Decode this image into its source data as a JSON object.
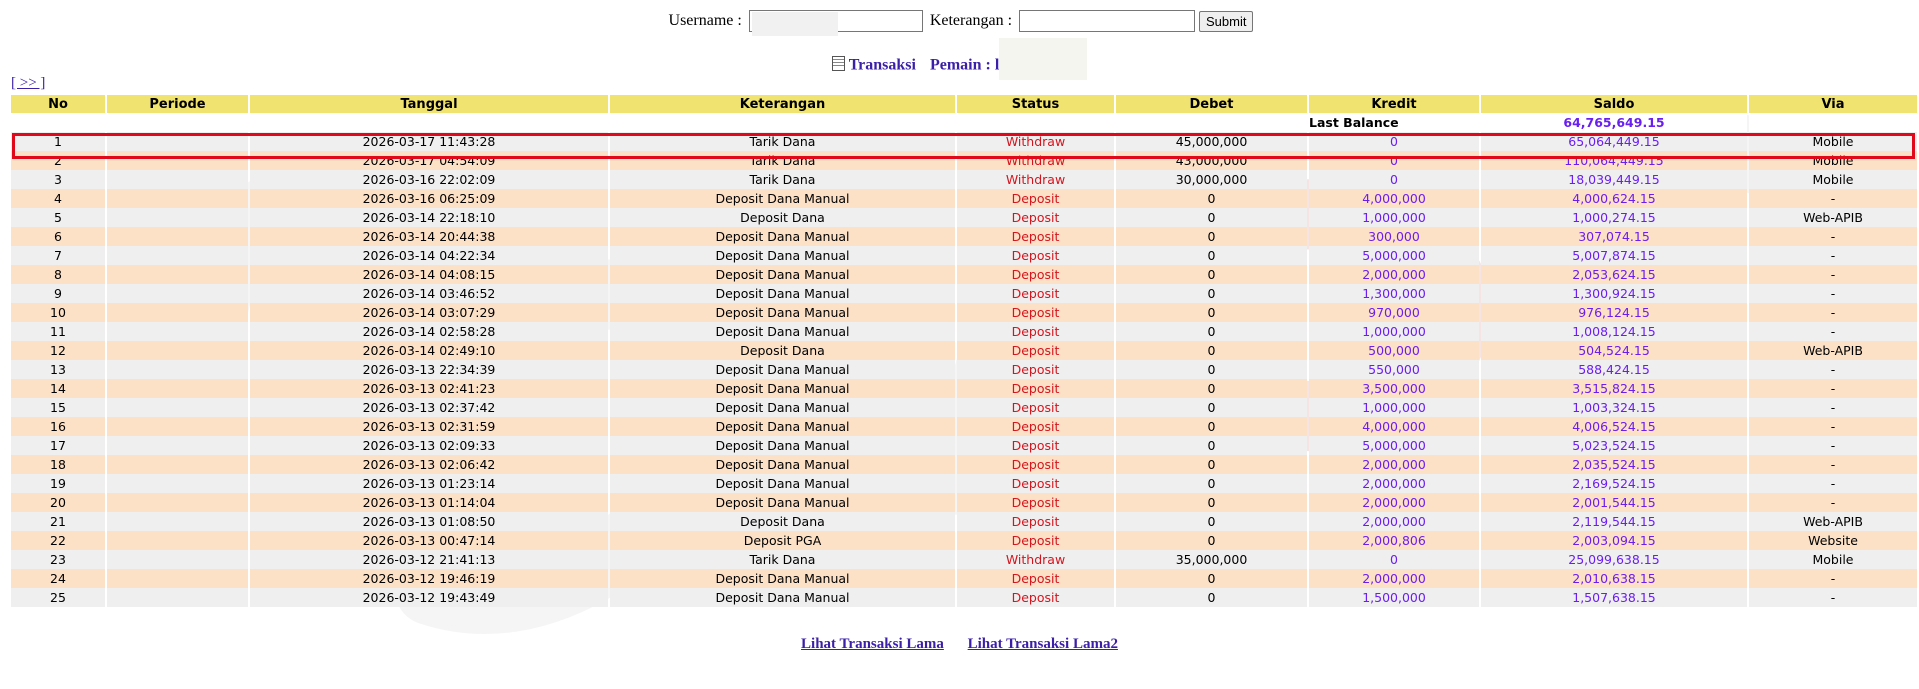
{
  "search": {
    "username_label": "Username :",
    "username_value": "l",
    "keterangan_label": "Keterangan :",
    "keterangan_value": "",
    "submit_label": "Submit"
  },
  "heading": {
    "title": "Transaksi",
    "player_label": "Pemain : l"
  },
  "nav": {
    "next_label": "[ >> ]"
  },
  "table": {
    "columns": [
      "No",
      "Periode",
      "Tanggal",
      "Keterangan",
      "Status",
      "Debet",
      "Kredit",
      "Saldo",
      "Via"
    ],
    "last_balance_label": "Last Balance",
    "last_balance_value": "64,765,649.15",
    "rows": [
      {
        "no": "1",
        "periode": "",
        "tanggal": "2026-03-17 11:43:28",
        "keterangan": "Tarik Dana",
        "status": "Withdraw",
        "debet": "45,000,000",
        "kredit": "0",
        "saldo": "65,064,449.15",
        "via": "Mobile"
      },
      {
        "no": "2",
        "periode": "",
        "tanggal": "2026-03-17 04:54:09",
        "keterangan": "Tarik Dana",
        "status": "Withdraw",
        "debet": "43,000,000",
        "kredit": "0",
        "saldo": "110,064,449.15",
        "via": "Mobile"
      },
      {
        "no": "3",
        "periode": "",
        "tanggal": "2026-03-16 22:02:09",
        "keterangan": "Tarik Dana",
        "status": "Withdraw",
        "debet": "30,000,000",
        "kredit": "0",
        "saldo": "18,039,449.15",
        "via": "Mobile"
      },
      {
        "no": "4",
        "periode": "",
        "tanggal": "2026-03-16 06:25:09",
        "keterangan": "Deposit Dana Manual",
        "status": "Deposit",
        "debet": "0",
        "kredit": "4,000,000",
        "saldo": "4,000,624.15",
        "via": "-"
      },
      {
        "no": "5",
        "periode": "",
        "tanggal": "2026-03-14 22:18:10",
        "keterangan": "Deposit Dana",
        "status": "Deposit",
        "debet": "0",
        "kredit": "1,000,000",
        "saldo": "1,000,274.15",
        "via": "Web-APIB"
      },
      {
        "no": "6",
        "periode": "",
        "tanggal": "2026-03-14 20:44:38",
        "keterangan": "Deposit Dana Manual",
        "status": "Deposit",
        "debet": "0",
        "kredit": "300,000",
        "saldo": "307,074.15",
        "via": "-"
      },
      {
        "no": "7",
        "periode": "",
        "tanggal": "2026-03-14 04:22:34",
        "keterangan": "Deposit Dana Manual",
        "status": "Deposit",
        "debet": "0",
        "kredit": "5,000,000",
        "saldo": "5,007,874.15",
        "via": "-"
      },
      {
        "no": "8",
        "periode": "",
        "tanggal": "2026-03-14 04:08:15",
        "keterangan": "Deposit Dana Manual",
        "status": "Deposit",
        "debet": "0",
        "kredit": "2,000,000",
        "saldo": "2,053,624.15",
        "via": "-"
      },
      {
        "no": "9",
        "periode": "",
        "tanggal": "2026-03-14 03:46:52",
        "keterangan": "Deposit Dana Manual",
        "status": "Deposit",
        "debet": "0",
        "kredit": "1,300,000",
        "saldo": "1,300,924.15",
        "via": "-"
      },
      {
        "no": "10",
        "periode": "",
        "tanggal": "2026-03-14 03:07:29",
        "keterangan": "Deposit Dana Manual",
        "status": "Deposit",
        "debet": "0",
        "kredit": "970,000",
        "saldo": "976,124.15",
        "via": "-"
      },
      {
        "no": "11",
        "periode": "",
        "tanggal": "2026-03-14 02:58:28",
        "keterangan": "Deposit Dana Manual",
        "status": "Deposit",
        "debet": "0",
        "kredit": "1,000,000",
        "saldo": "1,008,124.15",
        "via": "-"
      },
      {
        "no": "12",
        "periode": "",
        "tanggal": "2026-03-14 02:49:10",
        "keterangan": "Deposit Dana",
        "status": "Deposit",
        "debet": "0",
        "kredit": "500,000",
        "saldo": "504,524.15",
        "via": "Web-APIB"
      },
      {
        "no": "13",
        "periode": "",
        "tanggal": "2026-03-13 22:34:39",
        "keterangan": "Deposit Dana Manual",
        "status": "Deposit",
        "debet": "0",
        "kredit": "550,000",
        "saldo": "588,424.15",
        "via": "-"
      },
      {
        "no": "14",
        "periode": "",
        "tanggal": "2026-03-13 02:41:23",
        "keterangan": "Deposit Dana Manual",
        "status": "Deposit",
        "debet": "0",
        "kredit": "3,500,000",
        "saldo": "3,515,824.15",
        "via": "-"
      },
      {
        "no": "15",
        "periode": "",
        "tanggal": "2026-03-13 02:37:42",
        "keterangan": "Deposit Dana Manual",
        "status": "Deposit",
        "debet": "0",
        "kredit": "1,000,000",
        "saldo": "1,003,324.15",
        "via": "-"
      },
      {
        "no": "16",
        "periode": "",
        "tanggal": "2026-03-13 02:31:59",
        "keterangan": "Deposit Dana Manual",
        "status": "Deposit",
        "debet": "0",
        "kredit": "4,000,000",
        "saldo": "4,006,524.15",
        "via": "-"
      },
      {
        "no": "17",
        "periode": "",
        "tanggal": "2026-03-13 02:09:33",
        "keterangan": "Deposit Dana Manual",
        "status": "Deposit",
        "debet": "0",
        "kredit": "5,000,000",
        "saldo": "5,023,524.15",
        "via": "-"
      },
      {
        "no": "18",
        "periode": "",
        "tanggal": "2026-03-13 02:06:42",
        "keterangan": "Deposit Dana Manual",
        "status": "Deposit",
        "debet": "0",
        "kredit": "2,000,000",
        "saldo": "2,035,524.15",
        "via": "-"
      },
      {
        "no": "19",
        "periode": "",
        "tanggal": "2026-03-13 01:23:14",
        "keterangan": "Deposit Dana Manual",
        "status": "Deposit",
        "debet": "0",
        "kredit": "2,000,000",
        "saldo": "2,169,524.15",
        "via": "-"
      },
      {
        "no": "20",
        "periode": "",
        "tanggal": "2026-03-13 01:14:04",
        "keterangan": "Deposit Dana Manual",
        "status": "Deposit",
        "debet": "0",
        "kredit": "2,000,000",
        "saldo": "2,001,544.15",
        "via": "-"
      },
      {
        "no": "21",
        "periode": "",
        "tanggal": "2026-03-13 01:08:50",
        "keterangan": "Deposit Dana",
        "status": "Deposit",
        "debet": "0",
        "kredit": "2,000,000",
        "saldo": "2,119,544.15",
        "via": "Web-APIB"
      },
      {
        "no": "22",
        "periode": "",
        "tanggal": "2026-03-13 00:47:14",
        "keterangan": "Deposit PGA",
        "status": "Deposit",
        "debet": "0",
        "kredit": "2,000,806",
        "saldo": "2,003,094.15",
        "via": "Website"
      },
      {
        "no": "23",
        "periode": "",
        "tanggal": "2026-03-12 21:41:13",
        "keterangan": "Tarik Dana",
        "status": "Withdraw",
        "debet": "35,000,000",
        "kredit": "0",
        "saldo": "25,099,638.15",
        "via": "Mobile"
      },
      {
        "no": "24",
        "periode": "",
        "tanggal": "2026-03-12 19:46:19",
        "keterangan": "Deposit Dana Manual",
        "status": "Deposit",
        "debet": "0",
        "kredit": "2,000,000",
        "saldo": "2,010,638.15",
        "via": "-"
      },
      {
        "no": "25",
        "periode": "",
        "tanggal": "2026-03-12 19:43:49",
        "keterangan": "Deposit Dana Manual",
        "status": "Deposit",
        "debet": "0",
        "kredit": "1,500,000",
        "saldo": "1,507,638.15",
        "via": "-"
      }
    ]
  },
  "footer": {
    "link1": "Lihat Transaksi Lama",
    "link2": "Lihat Transaksi Lama2"
  },
  "colors": {
    "header_bg": "#f1e36f",
    "row_odd": "#efefef",
    "row_even": "#fde1c6",
    "status_red": "#d4151e",
    "value_purple": "#6a1ef0",
    "link_blue": "#3b1fa8",
    "highlight_border": "#e0091c"
  },
  "icons": {
    "heading_icon": "document-icon"
  }
}
